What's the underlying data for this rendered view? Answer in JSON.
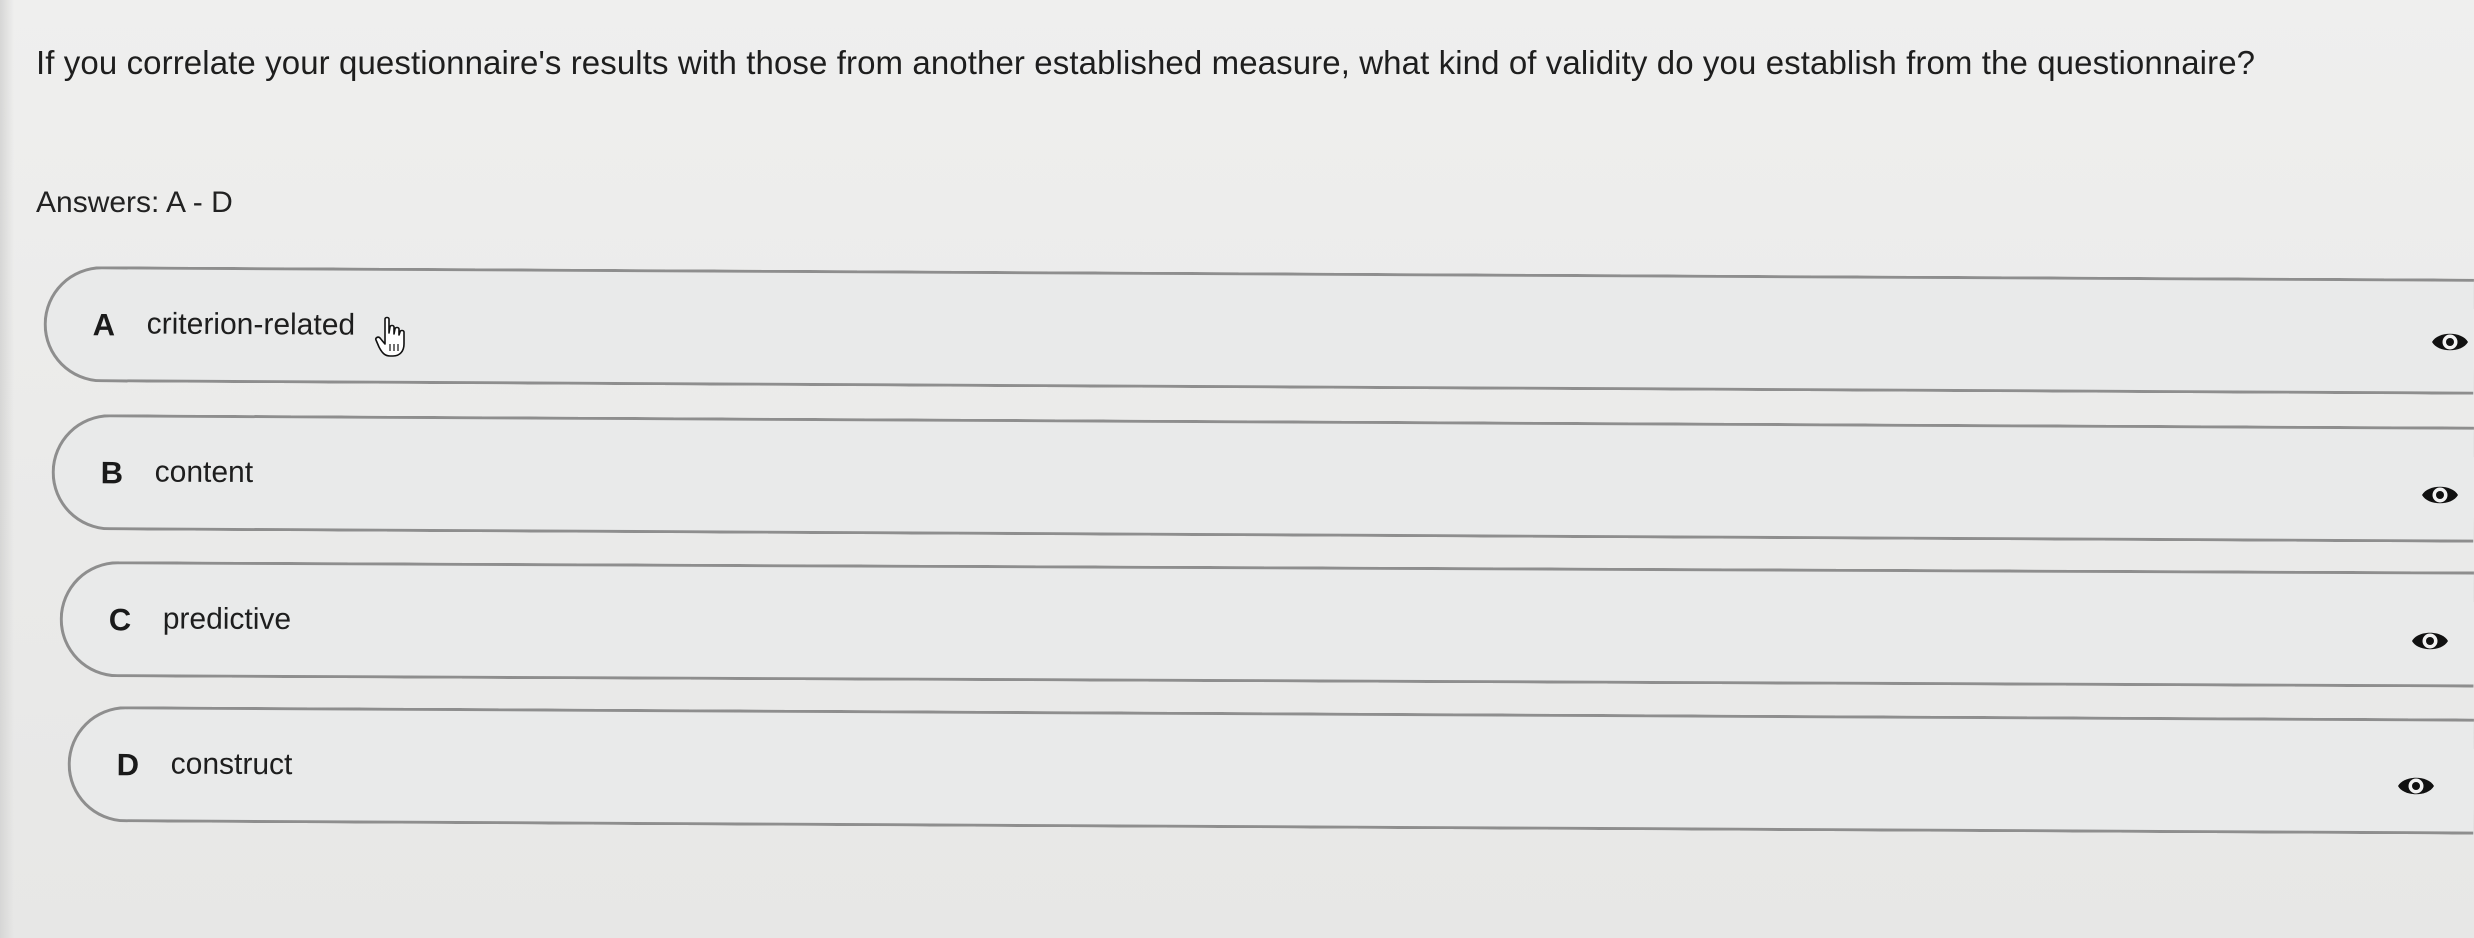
{
  "question": {
    "text": "If you correlate your questionnaire's results with those from another established measure, what kind of validity do you establish from the questionnaire?"
  },
  "answers_label": "Answers: A - D",
  "options": [
    {
      "letter": "A",
      "text": "criterion-related",
      "icon": "eye-icon"
    },
    {
      "letter": "B",
      "text": "content",
      "icon": "eye-icon"
    },
    {
      "letter": "C",
      "text": "predictive",
      "icon": "eye-icon"
    },
    {
      "letter": "D",
      "text": "construct",
      "icon": "eye-icon"
    }
  ],
  "cursor": {
    "icon": "hand-pointer-icon"
  },
  "colors": {
    "background": "#ececeb",
    "option_border": "#8e8e8e",
    "text": "#1e1e1e"
  }
}
